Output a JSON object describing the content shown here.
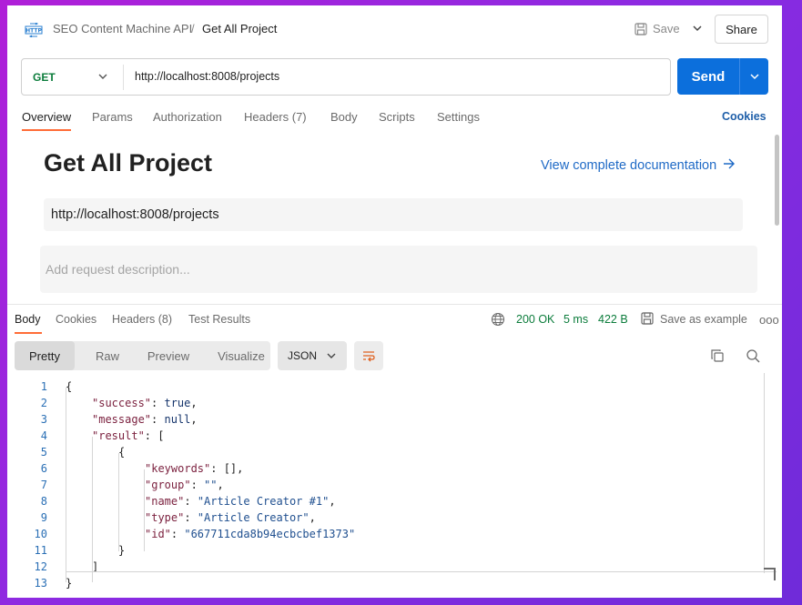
{
  "header": {
    "breadcrumb_parent": "SEO Content Machine API",
    "breadcrumb_sep": "/",
    "breadcrumb_current": "Get All Project",
    "save_label": "Save",
    "share_label": "Share"
  },
  "request": {
    "method": "GET",
    "url": "http://localhost:8008/projects",
    "send_label": "Send"
  },
  "request_tabs": {
    "overview": "Overview",
    "params": "Params",
    "authorization": "Authorization",
    "headers": "Headers (7)",
    "body": "Body",
    "scripts": "Scripts",
    "settings": "Settings",
    "cookies": "Cookies"
  },
  "overview": {
    "title": "Get All Project",
    "doc_link": "View complete documentation",
    "url": "http://localhost:8008/projects",
    "description_placeholder": "Add request description..."
  },
  "response_tabs": {
    "body": "Body",
    "cookies": "Cookies",
    "headers": "Headers (8)",
    "test_results": "Test Results"
  },
  "response_status": {
    "status": "200 OK",
    "time": "5 ms",
    "size": "422 B",
    "save_example": "Save as example",
    "more": "ooo"
  },
  "view_modes": {
    "pretty": "Pretty",
    "raw": "Raw",
    "preview": "Preview",
    "visualize": "Visualize",
    "format": "JSON"
  },
  "code": {
    "line_numbers": [
      "1",
      "2",
      "3",
      "4",
      "5",
      "6",
      "7",
      "8",
      "9",
      "10",
      "11",
      "12",
      "13"
    ],
    "l1": "{",
    "l2_key": "\"success\"",
    "l2_colon": ": ",
    "l2_val": "true",
    "l2_end": ",",
    "l3_key": "\"message\"",
    "l3_colon": ": ",
    "l3_val": "null",
    "l3_end": ",",
    "l4_key": "\"result\"",
    "l4_rest": ": [",
    "l5": "{",
    "l6_key": "\"keywords\"",
    "l6_rest": ": [],",
    "l7_key": "\"group\"",
    "l7_colon": ": ",
    "l7_val": "\"\"",
    "l7_end": ",",
    "l8_key": "\"name\"",
    "l8_colon": ": ",
    "l8_val": "\"Article Creator #1\"",
    "l8_end": ",",
    "l9_key": "\"type\"",
    "l9_colon": ": ",
    "l9_val": "\"Article Creator\"",
    "l9_end": ",",
    "l10_key": "\"id\"",
    "l10_colon": ": ",
    "l10_val": "\"667711cda8b94ecbcbef1373\"",
    "l11": "}",
    "l12": "]",
    "l13": "}"
  },
  "colors": {
    "send_button": "#0c6fdc",
    "active_tab_underline": "#ff6c37",
    "status_ok": "#0b7c3b",
    "link": "#1f6ac6"
  },
  "icons": [
    "http-icon",
    "save-icon",
    "chevron-down-icon",
    "globe-icon",
    "save-example-icon",
    "more-icon",
    "wrap-lines-icon",
    "copy-icon",
    "search-icon"
  ]
}
